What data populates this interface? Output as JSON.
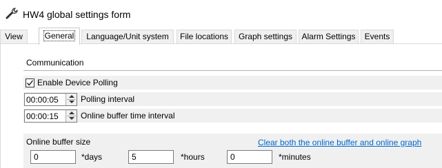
{
  "window": {
    "title": "HW4 global settings form",
    "icon": "wrench-icon"
  },
  "tabs": [
    {
      "label": "View",
      "selected": false
    },
    {
      "label": "General",
      "selected": true
    },
    {
      "label": "Language/Unit system",
      "selected": false
    },
    {
      "label": "File locations",
      "selected": false
    },
    {
      "label": "Graph settings",
      "selected": false
    },
    {
      "label": "Alarm Settings",
      "selected": false
    },
    {
      "label": "Events",
      "selected": false
    }
  ],
  "communication": {
    "group_title": "Communication",
    "enable_polling": {
      "label": "Enable Device Polling",
      "checked": true
    },
    "polling_interval": {
      "value": "00:00:05",
      "label": "Polling interval"
    },
    "online_buffer_interval": {
      "value": "00:00:15",
      "label": "Online buffer time interval"
    }
  },
  "online_buffer": {
    "title": "Online buffer size",
    "clear_link": "Clear both the online buffer and online graph",
    "days": {
      "value": "0",
      "label": "*days"
    },
    "hours": {
      "value": "5",
      "label": "*hours"
    },
    "minutes": {
      "value": "0",
      "label": "*minutes"
    }
  },
  "colors": {
    "link": "#0066cc",
    "row_background": "#f0f0f0"
  }
}
